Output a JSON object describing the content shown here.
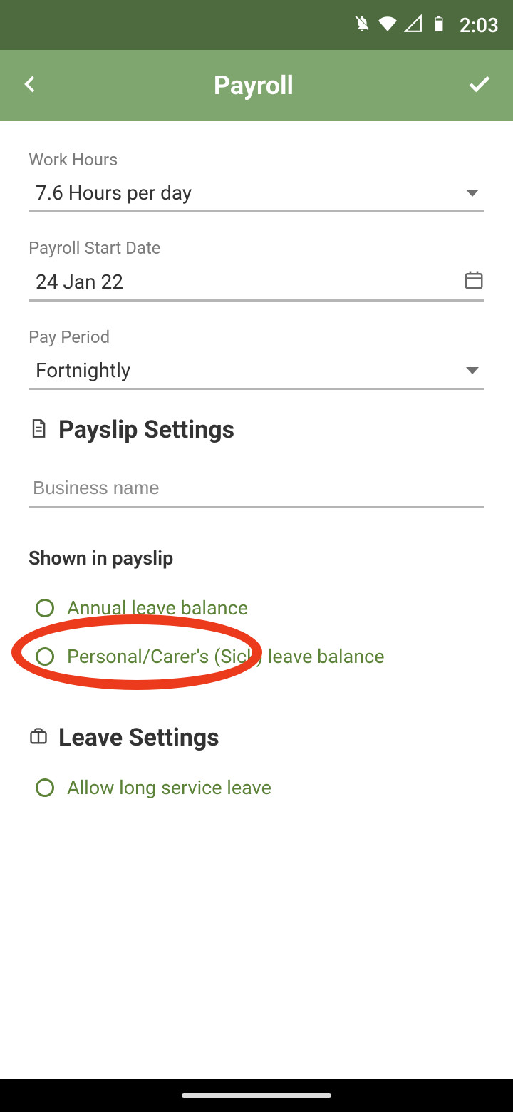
{
  "statusbar": {
    "time": "2:03"
  },
  "appbar": {
    "title": "Payroll"
  },
  "form": {
    "work_hours": {
      "label": "Work Hours",
      "value": "7.6 Hours per day"
    },
    "payroll_start_date": {
      "label": "Payroll Start Date",
      "value": "24 Jan 22"
    },
    "pay_period": {
      "label": "Pay Period",
      "value": "Fortnightly"
    }
  },
  "payslip_settings": {
    "title": "Payslip Settings",
    "business_name_placeholder": "Business name",
    "shown_in_payslip_label": "Shown in payslip",
    "options": {
      "annual_leave": "Annual leave balance",
      "sick_leave": "Personal/Carer's (Sick) leave balance"
    }
  },
  "leave_settings": {
    "title": "Leave Settings",
    "options": {
      "long_service": "Allow long service leave"
    }
  }
}
